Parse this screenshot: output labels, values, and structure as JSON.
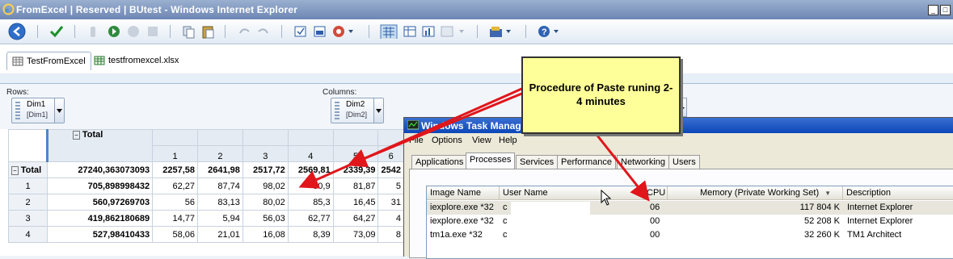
{
  "window": {
    "title": "FromExcel | Reserved | BUtest - Windows Internet Explorer"
  },
  "tabs": [
    {
      "label": "TestFromExcel"
    },
    {
      "label": "testfromexcel.xlsx"
    }
  ],
  "dims": {
    "rows_label": "Rows:",
    "columns_label": "Columns:",
    "row_dim": {
      "name": "Dim1",
      "sub": "[Dim1]"
    },
    "col_dim": {
      "name": "Dim2",
      "sub": "[Dim2]"
    }
  },
  "grid": {
    "total_header": "Total",
    "columns": [
      "1",
      "2",
      "3",
      "4",
      "5",
      "6"
    ],
    "rows": [
      {
        "label": "Total",
        "total": "27240,363073093",
        "cells": [
          "2257,58",
          "2641,98",
          "2517,72",
          "2569,81",
          "2339,39",
          "2542"
        ]
      },
      {
        "label": "1",
        "total": "705,898998432",
        "cells": [
          "62,27",
          "87,74",
          "98,02",
          "90,9",
          "81,87",
          "5"
        ]
      },
      {
        "label": "2",
        "total": "560,97269703",
        "cells": [
          "56",
          "83,13",
          "80,02",
          "85,3",
          "16,45",
          "31"
        ]
      },
      {
        "label": "3",
        "total": "419,862180689",
        "cells": [
          "14,77",
          "5,94",
          "56,03",
          "62,77",
          "64,27",
          "4"
        ]
      },
      {
        "label": "4",
        "total": "527,98410433",
        "cells": [
          "58,06",
          "21,01",
          "16,08",
          "8,39",
          "73,09",
          "8"
        ]
      }
    ]
  },
  "taskmgr": {
    "title": "Windows Task Manage",
    "menu": [
      "File",
      "Options",
      "View",
      "Help"
    ],
    "tabs": [
      "Applications",
      "Processes",
      "Services",
      "Performance",
      "Networking",
      "Users"
    ],
    "columns": [
      "Image Name",
      "User Name",
      "CPU",
      "Memory (Private Working Set)",
      "Description"
    ],
    "rows": [
      {
        "image": "iexplore.exe *32",
        "user": "c",
        "cpu": "06",
        "mem": "117 804 K",
        "desc": "Internet Explorer"
      },
      {
        "image": "iexplore.exe *32",
        "user": "c",
        "cpu": "00",
        "mem": "52 208 K",
        "desc": "Internet Explorer"
      },
      {
        "image": "tm1a.exe *32",
        "user": "c",
        "cpu": "00",
        "mem": "32 260 K",
        "desc": "TM1 Architect"
      }
    ]
  },
  "callout": {
    "text": "Procedure of Paste runing 2-4 minutes"
  },
  "colors": {
    "arrow": "#e0161b",
    "callout_bg": "#ffff99",
    "xp_title": "#0b47b8"
  }
}
